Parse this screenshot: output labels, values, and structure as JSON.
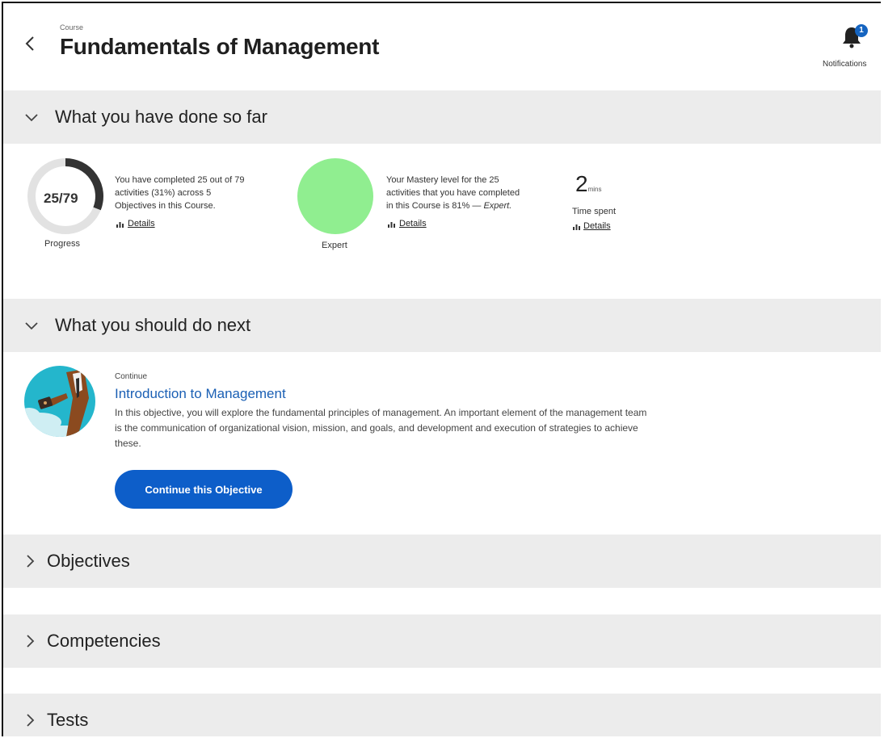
{
  "header": {
    "course_label": "Course",
    "title": "Fundamentals of Management",
    "notifications_label": "Notifications",
    "notifications_count": "1"
  },
  "sections": {
    "done": {
      "title": "What you have done so far"
    },
    "next": {
      "title": "What you should do next"
    },
    "objectives": {
      "title": "Objectives"
    },
    "competencies": {
      "title": "Competencies"
    },
    "tests": {
      "title": "Tests"
    }
  },
  "progress": {
    "value_text": "25/79",
    "fraction": 0.31,
    "caption": "Progress",
    "description_lines": [
      "You have completed 25 out of 79",
      "activities (31%) across 5",
      "Objectives in this Course."
    ],
    "details_label": "Details"
  },
  "mastery": {
    "caption": "Expert",
    "color": "#90ee90",
    "description_lines": [
      "Your Mastery level for the 25",
      "activities that you have completed",
      "in this Course is 81% — "
    ],
    "level_italic": "Expert.",
    "details_label": "Details"
  },
  "time": {
    "value": "2",
    "unit": "mins",
    "caption": "Time spent",
    "details_label": "Details"
  },
  "next": {
    "continue_label": "Continue",
    "objective_title": "Introduction to Management",
    "description": "In this objective, you will explore the fundamental principles of management. An important element of the management team is the communication of organizational vision, mission, and goals, and development and execution of strategies to achieve these.",
    "button_label": "Continue this Objective"
  },
  "colors": {
    "accent": "#0d5ec9",
    "link": "#1a5fb4",
    "section_bg": "#ececec"
  }
}
